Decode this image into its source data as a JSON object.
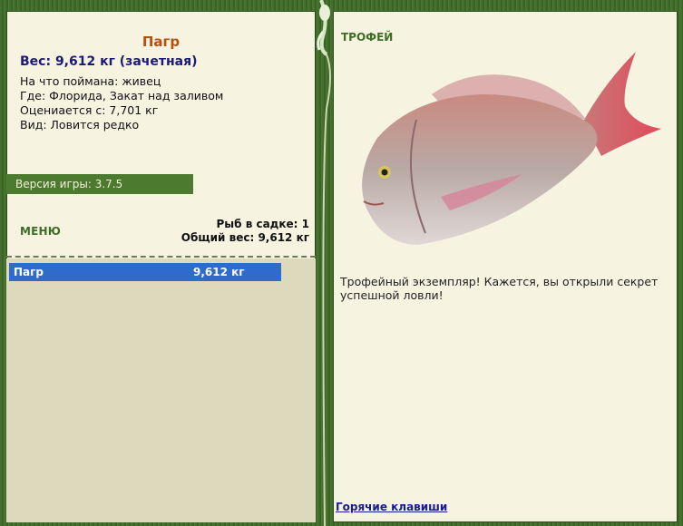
{
  "fish": {
    "name": "Пагр",
    "weight_line": "Вес: 9,612 кг (зачетная)",
    "info": [
      "На что поймана: живец",
      "Где: Флорида, Закат над заливом",
      "Оцениается с: 7,701 кг",
      "Вид: Ловится редко"
    ]
  },
  "version": "Версия игры: 3.7.5",
  "menu_label": "МЕНЮ",
  "keep": {
    "count_line": "Рыб в садке: 1",
    "total_line": "Общий вес: 9,612 кг"
  },
  "catch_list": [
    {
      "name": "Пагр",
      "weight": "9,612 кг"
    }
  ],
  "trophy": {
    "label": "ТРОФЕЙ",
    "description": "Трофейный экземпляр! Кажется, вы открыли секрет успешной ловли!"
  },
  "hotkeys_link": "Горячие клавиши",
  "colors": {
    "frame": "#3f6a2a",
    "panel": "#f6f3e1",
    "accent_green": "#4c7a2f",
    "selection": "#2f6bcb",
    "fish_name": "#b5500f"
  }
}
